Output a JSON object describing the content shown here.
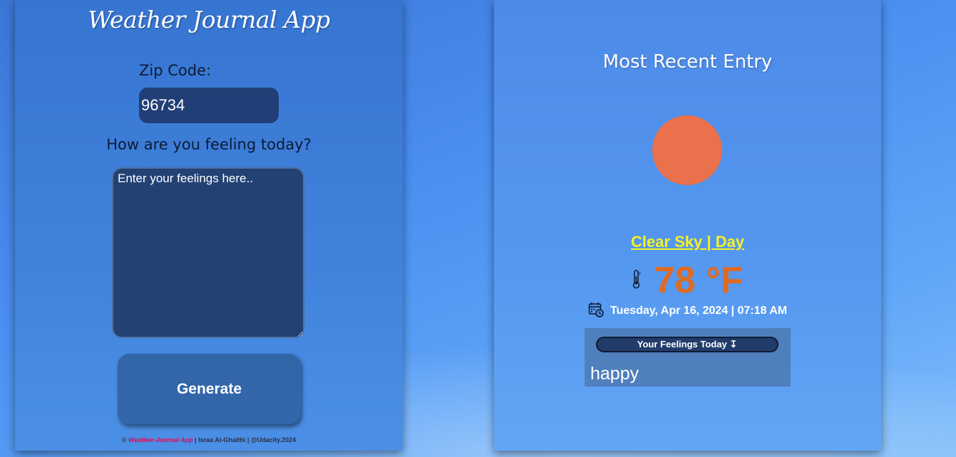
{
  "left_panel": {
    "title": "Weather Journal App",
    "zip_label": "Zip Code:",
    "zip_value": "96734",
    "feelings_label": "How are you feeling today?",
    "feelings_placeholder": "Enter your feelings here..",
    "generate_label": "Generate",
    "footer": {
      "copyright": "©",
      "app_name": "Weather-Journal App",
      "rest": "| Israa Al-Ghaithi | @Udacity.2024"
    }
  },
  "right_panel": {
    "title": "Most Recent Entry",
    "condition": "Clear Sky | Day",
    "temperature": "78 °F",
    "date": "Tuesday, Apr 16, 2024 | 07:18 AM",
    "feelings_header": "Your Feelings Today ↧",
    "feelings_value": "happy",
    "icons": {
      "weather": "sun-icon",
      "temperature": "thermometer-icon",
      "date": "calendar-clock-icon"
    }
  },
  "colors": {
    "sun": "#ea714b",
    "condition": "#f7f21e",
    "temperature": "#e06a22",
    "input_bg": "#213f76",
    "footer_app_name": "#d0105a"
  }
}
